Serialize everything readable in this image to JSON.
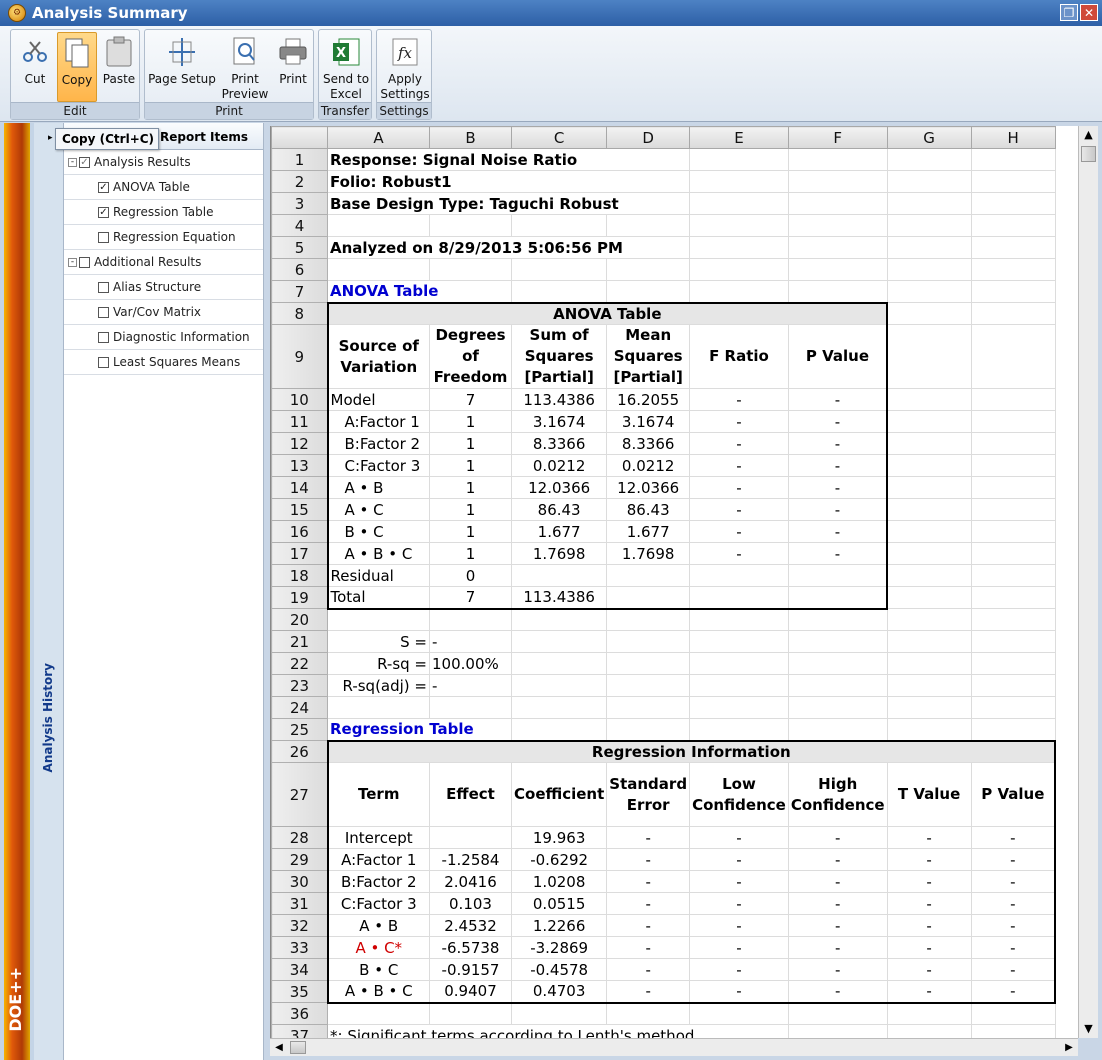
{
  "window": {
    "title": "Analysis Summary"
  },
  "ribbon": {
    "groups": [
      {
        "label": "Edit",
        "buttons": [
          "Cut",
          "Copy",
          "Paste"
        ]
      },
      {
        "label": "Print",
        "buttons": [
          "Page Setup",
          "Print Preview",
          "Print"
        ]
      },
      {
        "label": "Transfer",
        "buttons": [
          "Send to Excel"
        ]
      },
      {
        "label": "Settings",
        "buttons": [
          "Apply Settings"
        ]
      }
    ],
    "labels": {
      "cut": "Cut",
      "copy": "Copy",
      "paste": "Paste",
      "page_setup": "Page Setup",
      "print_preview_1": "Print",
      "print_preview_2": "Preview",
      "print": "Print",
      "send_1": "Send to",
      "send_2": "Excel",
      "apply_1": "Apply",
      "apply_2": "Settings",
      "edit": "Edit",
      "print_group": "Print",
      "transfer": "Transfer",
      "settings": "Settings"
    }
  },
  "tooltip": "Copy (Ctrl+C)",
  "sidebar": {
    "history_label": "Analysis History",
    "logo": "DOE++"
  },
  "panel": {
    "header": "Report Items",
    "items": [
      {
        "label": "Analysis Results",
        "checked": true,
        "level": 0,
        "expander": "-"
      },
      {
        "label": "ANOVA Table",
        "checked": true,
        "level": 1
      },
      {
        "label": "Regression Table",
        "checked": true,
        "level": 1
      },
      {
        "label": "Regression Equation",
        "checked": false,
        "level": 1
      },
      {
        "label": "Additional Results",
        "checked": false,
        "level": 0,
        "expander": "-"
      },
      {
        "label": "Alias Structure",
        "checked": false,
        "level": 1
      },
      {
        "label": "Var/Cov Matrix",
        "checked": false,
        "level": 1
      },
      {
        "label": "Diagnostic Information",
        "checked": false,
        "level": 1
      },
      {
        "label": "Least Squares Means",
        "checked": false,
        "level": 1
      }
    ]
  },
  "sheet": {
    "columns": [
      "A",
      "B",
      "C",
      "D",
      "E",
      "F",
      "G",
      "H"
    ],
    "rows": [
      "1",
      "2",
      "3",
      "4",
      "5",
      "6",
      "7",
      "8",
      "9",
      "10",
      "11",
      "12",
      "13",
      "14",
      "15",
      "16",
      "17",
      "18",
      "19",
      "20",
      "21",
      "22",
      "23",
      "24",
      "25",
      "26",
      "27",
      "28",
      "29",
      "30",
      "31",
      "32",
      "33",
      "34",
      "35",
      "36",
      "37"
    ],
    "response": "Response: Signal Noise Ratio",
    "folio": "Folio: Robust1",
    "design": "Base Design Type: Taguchi Robust",
    "analyzed": "Analyzed on 8/29/2013 5:06:56 PM",
    "anova_link": "ANOVA Table",
    "anova": {
      "title": "ANOVA Table",
      "headers": [
        "Source of Variation",
        "Degrees of Freedom",
        "Sum of Squares [Partial]",
        "Mean Squares [Partial]",
        "F Ratio",
        "P Value"
      ],
      "rows": [
        [
          "Model",
          "7",
          "113.4386",
          "16.2055",
          "-",
          "-"
        ],
        [
          "A:Factor 1",
          "1",
          "3.1674",
          "3.1674",
          "-",
          "-"
        ],
        [
          "B:Factor 2",
          "1",
          "8.3366",
          "8.3366",
          "-",
          "-"
        ],
        [
          "C:Factor 3",
          "1",
          "0.0212",
          "0.0212",
          "-",
          "-"
        ],
        [
          "A • B",
          "1",
          "12.0366",
          "12.0366",
          "-",
          "-"
        ],
        [
          "A • C",
          "1",
          "86.43",
          "86.43",
          "-",
          "-"
        ],
        [
          "B • C",
          "1",
          "1.677",
          "1.677",
          "-",
          "-"
        ],
        [
          "A • B • C",
          "1",
          "1.7698",
          "1.7698",
          "-",
          "-"
        ],
        [
          "Residual",
          "0",
          "",
          "",
          "",
          ""
        ],
        [
          "Total",
          "7",
          "113.4386",
          "",
          "",
          ""
        ]
      ]
    },
    "stats": {
      "s_label": "S =",
      "s_value": "-",
      "rsq_label": "R-sq =",
      "rsq_value": "100.00%",
      "rsqadj_label": "R-sq(adj) =",
      "rsqadj_value": "-"
    },
    "regression_link": "Regression Table",
    "regression": {
      "title": "Regression Information",
      "headers": [
        "Term",
        "Effect",
        "Coefficient",
        "Standard Error",
        "Low Confidence",
        "High Confidence",
        "T Value",
        "P Value"
      ],
      "rows": [
        [
          "Intercept",
          "",
          "19.963",
          "-",
          "-",
          "-",
          "-",
          "-"
        ],
        [
          "A:Factor 1",
          "-1.2584",
          "-0.6292",
          "-",
          "-",
          "-",
          "-",
          "-"
        ],
        [
          "B:Factor 2",
          "2.0416",
          "1.0208",
          "-",
          "-",
          "-",
          "-",
          "-"
        ],
        [
          "C:Factor 3",
          "0.103",
          "0.0515",
          "-",
          "-",
          "-",
          "-",
          "-"
        ],
        [
          "A • B",
          "2.4532",
          "1.2266",
          "-",
          "-",
          "-",
          "-",
          "-"
        ],
        [
          "A • C*",
          "-6.5738",
          "-3.2869",
          "-",
          "-",
          "-",
          "-",
          "-"
        ],
        [
          "B • C",
          "-0.9157",
          "-0.4578",
          "-",
          "-",
          "-",
          "-",
          "-"
        ],
        [
          "A • B • C",
          "0.9407",
          "0.4703",
          "-",
          "-",
          "-",
          "-",
          "-"
        ]
      ],
      "highlight_row": 5,
      "highlight_color": "#d00000"
    },
    "footnote": "*: Significant terms according to Lenth's method"
  }
}
